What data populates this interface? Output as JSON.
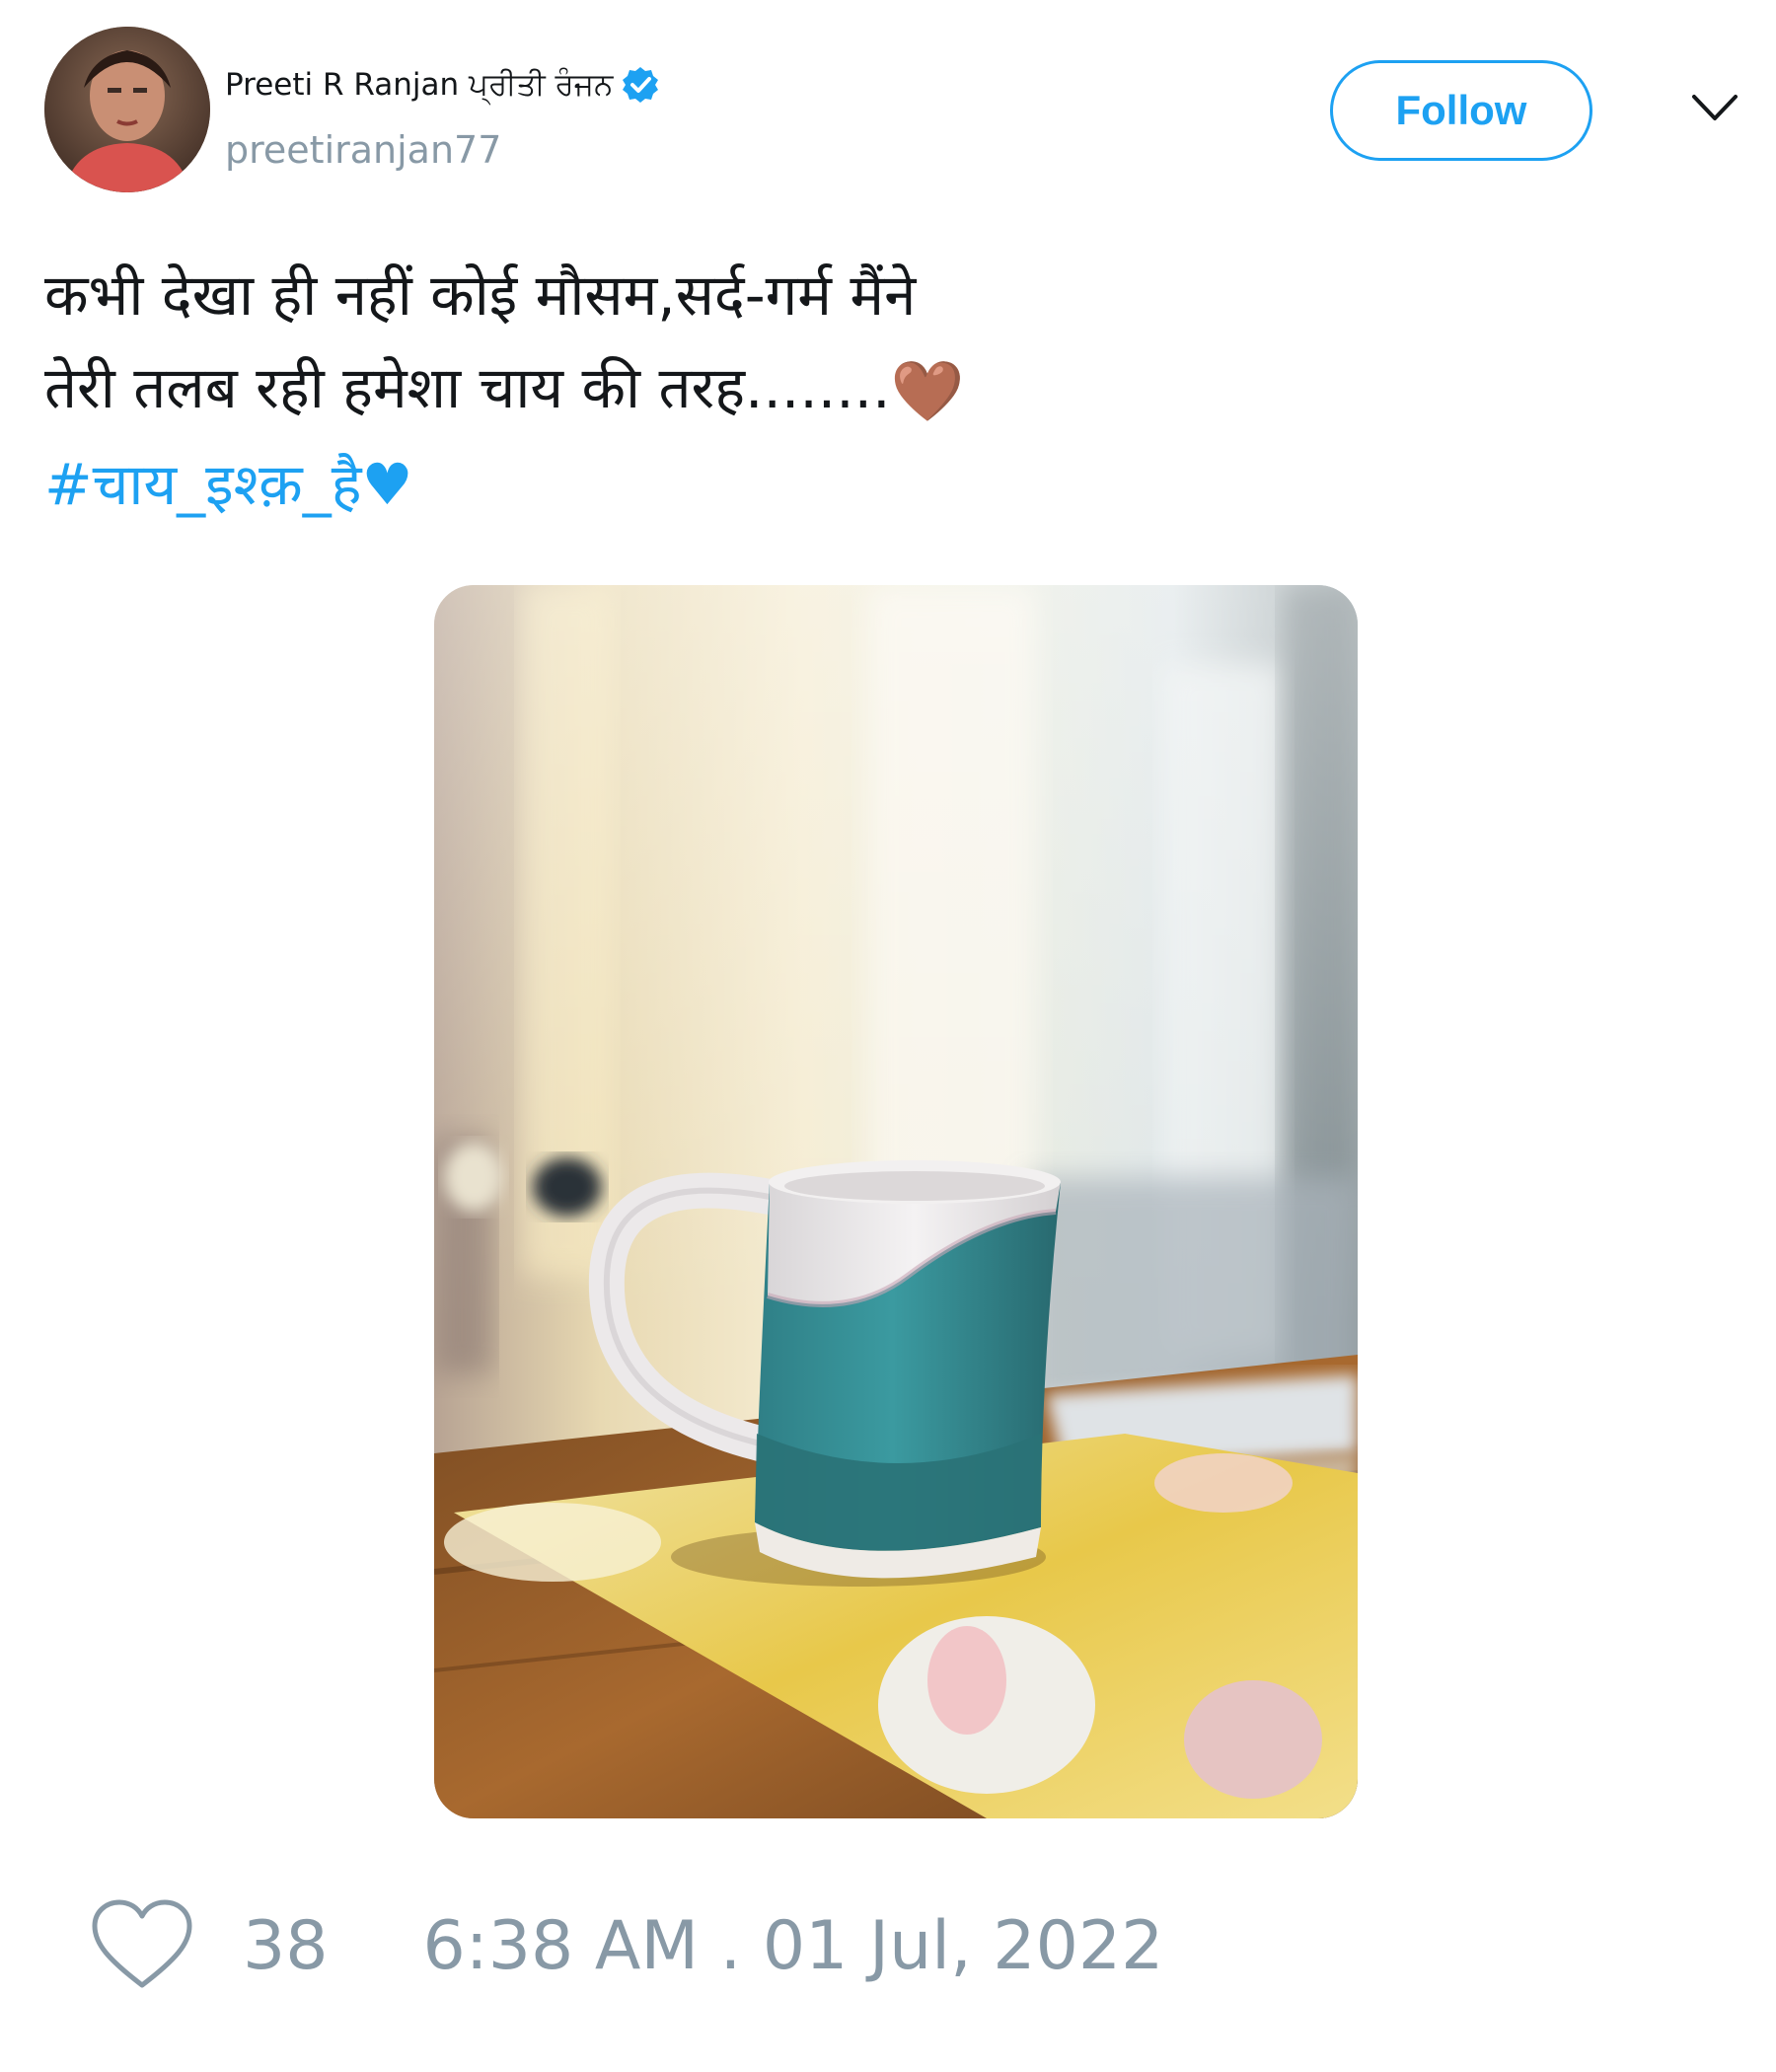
{
  "user": {
    "display_name": "Preeti R Ranjan ਪ੍ਰੀਤੀ ਰੰਜਨ",
    "handle": "preetiranjan77",
    "verified": true
  },
  "follow_button": {
    "label": "Follow"
  },
  "menu": {
    "icon": "chevron-down-icon"
  },
  "tweet": {
    "lines": [
      "कभी देखा ही नहीं कोई मौसम,सर्द-गर्म मैंने",
      "तेरी तलब रही हमेशा चाय की तरह........"
    ],
    "line2_emoji": "🤎",
    "hashtag": "#चाय_इश्क़_है",
    "hashtag_emoji": "♥"
  },
  "media": {
    "description_icon": "photo-tea-mug"
  },
  "footer": {
    "like_count": "38",
    "timestamp": "6:38 AM . 01 Jul, 2022"
  },
  "colors": {
    "accent": "#1da1f2",
    "muted": "#8899a6",
    "text": "#14171a"
  }
}
